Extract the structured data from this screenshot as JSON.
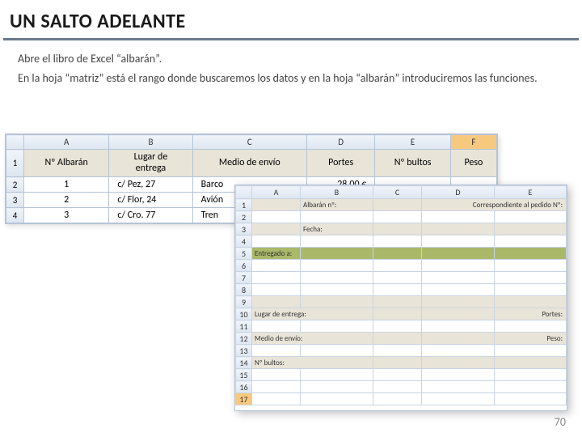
{
  "title": "UN SALTO ADELANTE",
  "para1": "Abre el libro de Excel “albarán”.",
  "para2": "En la hoja “matriz” está el rango donde buscaremos los datos y en la hoja “albarán” introduciremos las funciones.",
  "page_number": "70",
  "top_sheet": {
    "cols": [
      "A",
      "B",
      "C",
      "D",
      "E",
      "F"
    ],
    "headers": {
      "A": "Nº Albarán",
      "B": "Lugar de\nentrega",
      "C": "Medio de envío",
      "D": "Portes",
      "E": "Nº bultos",
      "F": "Peso"
    },
    "rows": [
      {
        "n": "2",
        "A": "1",
        "B": "c/ Pez, 27",
        "C": "Barco",
        "D": "28.00 €"
      },
      {
        "n": "3",
        "A": "2",
        "B": "c/ Flor, 24",
        "C": "Avión",
        "D": ""
      },
      {
        "n": "4",
        "A": "3",
        "B": "c/ Cro. 77",
        "C": "Tren",
        "D": ""
      }
    ]
  },
  "bot_sheet": {
    "cols": [
      "A",
      "B",
      "C",
      "D",
      "E"
    ],
    "labels": {
      "r1_b": "Albarán nº:",
      "r1_e": "Correspondiente al pedido Nº:",
      "r3_b": "Fecha:",
      "r5_a": "Entregado a:",
      "r10_a": "Lugar de entrega:",
      "r10_e": "Portes:",
      "r12_a": "Medio de envío:",
      "r12_e": "Peso:",
      "r14_a": "Nº bultos:"
    },
    "row_count": 17,
    "selected_row": 17
  }
}
